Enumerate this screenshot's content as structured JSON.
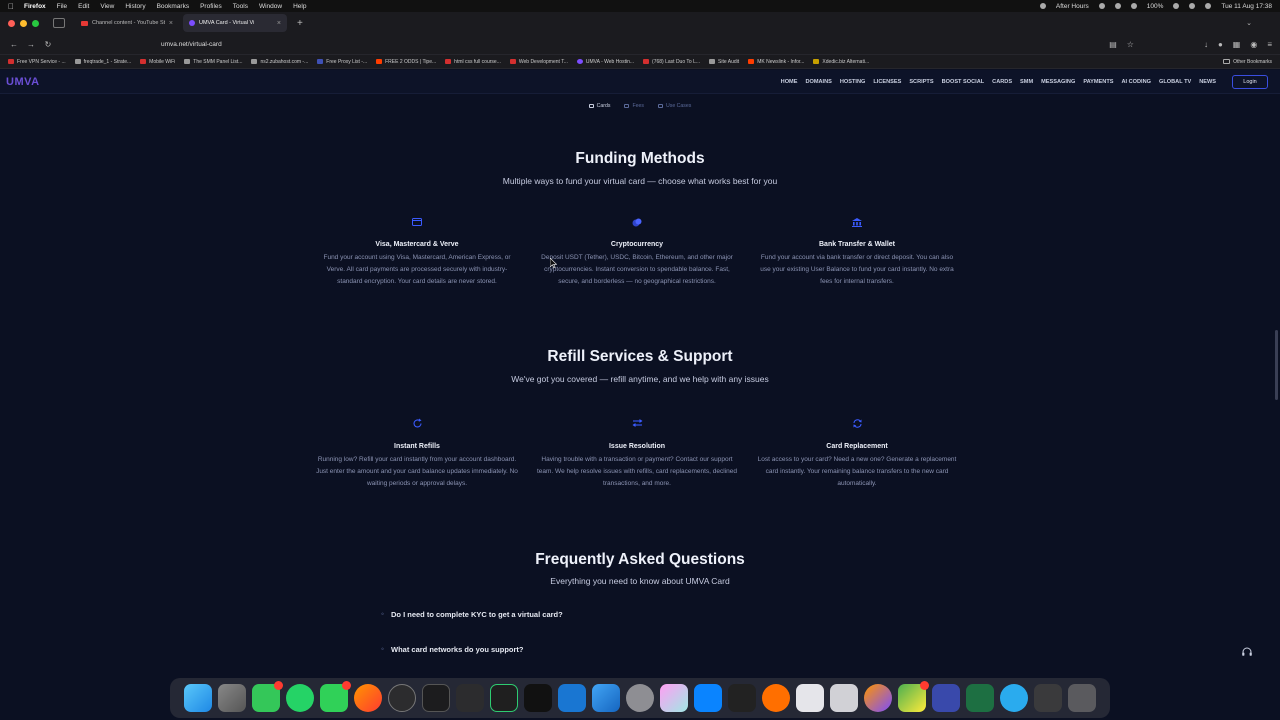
{
  "menubar": {
    "items": [
      "Firefox",
      "File",
      "Edit",
      "View",
      "History",
      "Bookmarks",
      "Profiles",
      "Tools",
      "Window",
      "Help"
    ],
    "status": "After Hours",
    "battery": "100%",
    "clock": "Tue 11 Aug  17:38"
  },
  "tabs": [
    {
      "title": "Channel content - YouTube Stu",
      "active": false
    },
    {
      "title": "UMVA Card - Virtual Vi",
      "active": true
    }
  ],
  "address": {
    "url": "umva.net/virtual-card"
  },
  "bookmarks": [
    "Free VPN Service - ...",
    "freqtrade_1 - Strate...",
    "Mobile WiFi",
    "The SMM Panel List...",
    "ns2.zubahost.com -...",
    "Free Proxy List -...",
    "FREE 2 ODDS | Tipe...",
    "html css full course...",
    "Web Development T...",
    "UMVA - Web Hostin...",
    "(768) Last Duo To L...",
    "Site Audit",
    "MK Newslink - Infor...",
    "Xdedic.biz Alternati..."
  ],
  "bookmarks_other": "Other Bookmarks",
  "site": {
    "logo": "UMVA",
    "nav": [
      "HOME",
      "DOMAINS",
      "HOSTING",
      "LICENSES",
      "SCRIPTS",
      "BOOST SOCIAL",
      "CARDS",
      "SMM",
      "MESSAGING",
      "PAYMENTS",
      "AI CODING",
      "GLOBAL TV",
      "NEWS"
    ],
    "login": "Login"
  },
  "subtabs": [
    "Cards",
    "Fees",
    "Use Cases"
  ],
  "funding": {
    "title": "Funding Methods",
    "subtitle": "Multiple ways to fund your virtual card — choose what works best for you",
    "cards": [
      {
        "title": "Visa, Mastercard & Verve",
        "desc": "Fund your account using Visa, Mastercard, American Express, or Verve. All card payments are processed securely with industry-standard encryption. Your card details are never stored."
      },
      {
        "title": "Cryptocurrency",
        "desc": "Deposit USDT (Tether), USDC, Bitcoin, Ethereum, and other major cryptocurrencies. Instant conversion to spendable balance. Fast, secure, and borderless — no geographical restrictions."
      },
      {
        "title": "Bank Transfer & Wallet",
        "desc": "Fund your account via bank transfer or direct deposit. You can also use your existing User Balance to fund your card instantly. No extra fees for internal transfers."
      }
    ]
  },
  "refill": {
    "title": "Refill Services & Support",
    "subtitle": "We've got you covered — refill anytime, and we help with any issues",
    "cards": [
      {
        "title": "Instant Refills",
        "desc": "Running low? Refill your card instantly from your account dashboard. Just enter the amount and your card balance updates immediately. No waiting periods or approval delays."
      },
      {
        "title": "Issue Resolution",
        "desc": "Having trouble with a transaction or payment? Contact our support team. We help resolve issues with refills, card replacements, declined transactions, and more."
      },
      {
        "title": "Card Replacement",
        "desc": "Lost access to your card? Need a new one? Generate a replacement card instantly. Your remaining balance transfers to the new card automatically."
      }
    ]
  },
  "faq": {
    "title": "Frequently Asked Questions",
    "subtitle": "Everything you need to know about UMVA Card",
    "items": [
      "Do I need to complete KYC to get a virtual card?",
      "What card networks do you support?"
    ]
  },
  "colors": {
    "accent": "#3b5bff",
    "logo": "#6b4fd6",
    "background": "#0b1022"
  }
}
